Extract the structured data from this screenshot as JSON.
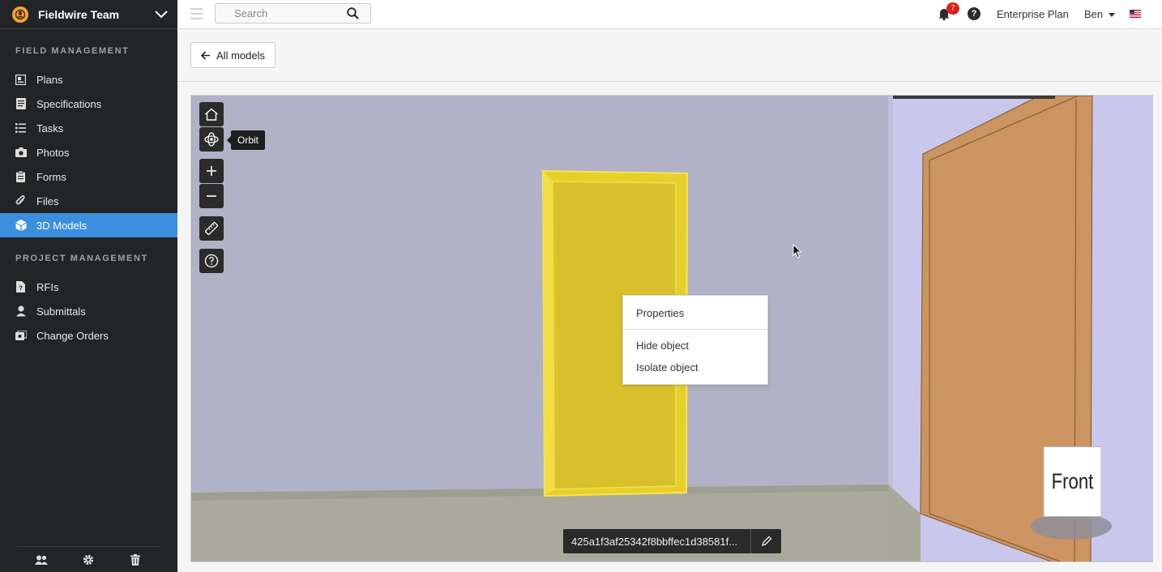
{
  "sidebar": {
    "team_name": "Fieldwire Team",
    "field_management_label": "FIELD MANAGEMENT",
    "project_management_label": "PROJECT MANAGEMENT",
    "field_items": [
      {
        "label": "Plans",
        "icon": "plans-icon"
      },
      {
        "label": "Specifications",
        "icon": "specifications-icon"
      },
      {
        "label": "Tasks",
        "icon": "tasks-icon"
      },
      {
        "label": "Photos",
        "icon": "camera-icon"
      },
      {
        "label": "Forms",
        "icon": "clipboard-icon"
      },
      {
        "label": "Files",
        "icon": "paperclip-icon"
      },
      {
        "label": "3D Models",
        "icon": "cube-icon",
        "active": true
      }
    ],
    "project_items": [
      {
        "label": "RFIs",
        "icon": "rfi-icon"
      },
      {
        "label": "Submittals",
        "icon": "user-icon"
      },
      {
        "label": "Change Orders",
        "icon": "change-orders-icon"
      }
    ],
    "footer_icons": [
      "people-icon",
      "gear-icon",
      "trash-icon"
    ]
  },
  "topbar": {
    "search_placeholder": "Search",
    "notification_count": "7",
    "help_label": "?",
    "plan": "Enterprise Plan",
    "user": "Ben"
  },
  "header": {
    "back_label": "All models"
  },
  "viewer": {
    "tooltip": "Orbit",
    "tools": [
      "home-icon",
      "orbit-icon",
      "zoom-in-icon",
      "zoom-out-icon",
      "measure-icon",
      "help-icon"
    ],
    "context_menu": {
      "properties": "Properties",
      "hide": "Hide object",
      "isolate": "Isolate object"
    },
    "object_id": "425a1f3af25342f8bbffec1d38581f...",
    "view_cube_label": "Front",
    "colors": {
      "wall": "#b1b1c7",
      "floor": "#a9aa9b",
      "selected_door": "#dbc42c",
      "side_wall": "#c9c7ec",
      "side_door": "#cc9460"
    }
  },
  "colors": {
    "sidebar_bg": "#222426",
    "active_nav": "#3b8fde",
    "badge": "#e01d1d"
  }
}
